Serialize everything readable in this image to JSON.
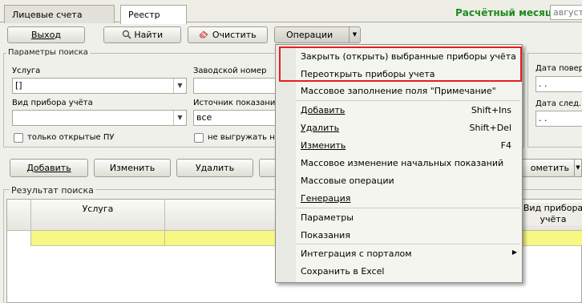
{
  "tabs": {
    "accounts": "Лицевые счета",
    "registry": "Реестр"
  },
  "header": {
    "month_label": "Расчётный месяц",
    "month_value": "август"
  },
  "toolbar": {
    "exit": "Выход",
    "find": "Найти",
    "clear": "Очистить",
    "operations": "Операции"
  },
  "search": {
    "legend": "Параметры поиска",
    "service_label": "Услуга",
    "service_value": "[]",
    "factory_label": "Заводской номер",
    "factory_value": "",
    "device_type_label": "Вид прибора учёта",
    "device_type_value": "",
    "source_label": "Источник показаний",
    "source_value": "все",
    "only_open_label": "только открытые ПУ",
    "no_export_label": "не выгружать на",
    "date_check_label": "Дата повер",
    "date_check_value": ". .",
    "date_next_label": "Дата след.п",
    "date_next_value": ". ."
  },
  "actions": {
    "add": "Добавить",
    "edit": "Изменить",
    "delete": "Удалить",
    "mark": "ометить"
  },
  "results": {
    "legend": "Результат поиска",
    "col_service": "Услуга",
    "col_device_type": "Вид прибора учёта"
  },
  "menu": {
    "items": [
      {
        "label": "Закрыть (открыть) выбранные приборы учёта",
        "shortcut": ""
      },
      {
        "label": "Переоткрыть приборы учета",
        "shortcut": ""
      },
      {
        "label": "Массовое заполнение поля \"Примечание\"",
        "shortcut": ""
      },
      {
        "label": "Добавить",
        "shortcut": "Shift+Ins"
      },
      {
        "label": "Удалить",
        "shortcut": "Shift+Del"
      },
      {
        "label": "Изменить",
        "shortcut": "F4"
      },
      {
        "label": "Массовое изменение начальных показаний",
        "shortcut": ""
      },
      {
        "label": "Массовые операции",
        "shortcut": ""
      },
      {
        "label": "Генерация",
        "shortcut": ""
      },
      {
        "label": "Параметры",
        "shortcut": ""
      },
      {
        "label": "Показания",
        "shortcut": ""
      },
      {
        "label": "Интеграция с порталом",
        "shortcut": ""
      },
      {
        "label": "Сохранить в Excel",
        "shortcut": ""
      }
    ]
  }
}
